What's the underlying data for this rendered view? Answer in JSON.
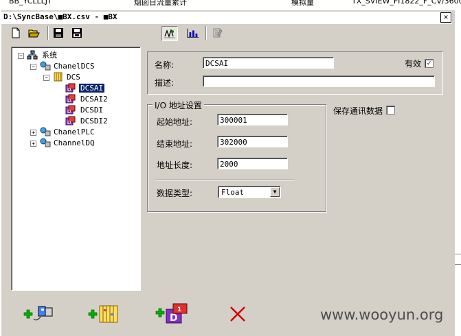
{
  "background_strip": {
    "col1": "BB_YCLLLJT",
    "col2": "烟囱日流量累计",
    "col3": "模拟量",
    "col4": "TX_SVIEW_FI1822_F_CV/3600"
  },
  "window": {
    "title": "D:\\SyncBase\\■BX.csv - ■BX",
    "close_label": "✕"
  },
  "toolbar": {
    "icons": [
      "new-icon",
      "open-icon",
      "save-icon",
      "save-all-icon",
      "signal-icon",
      "bar-chart-icon",
      "edit-doc-icon"
    ]
  },
  "tree": {
    "root": "系统",
    "nodes": {
      "chaneldcs": "ChanelDCS",
      "dcs": "DCS",
      "dcsai": "DCSAI",
      "dcsai2": "DCSAI2",
      "dcsdi": "DCSDI",
      "dcsdi2": "DCSDI2",
      "chanelplc": "ChanelPLC",
      "channeldq": "ChannelDQ"
    },
    "expander_minus": "−",
    "expander_plus": "+"
  },
  "props": {
    "name_label": "名称:",
    "name_value": "DCSAI",
    "valid_label": "有效",
    "valid_checked": "✓",
    "desc_label": "描述:",
    "desc_value": "",
    "save_comm_label": "保存通讯数据",
    "io_group_title": "I/O 地址设置",
    "start_label": "起始地址:",
    "start_value": "300001",
    "end_label": "结束地址:",
    "end_value": "302000",
    "length_label": "地址长度:",
    "length_value": "2000",
    "dtype_label": "数据类型:",
    "dtype_value": "Float",
    "dropdown_arrow": "▼"
  },
  "bottom_toolbar": {
    "icons": [
      "add-channel-icon",
      "add-device-icon",
      "add-datablock-icon",
      "delete-icon"
    ]
  },
  "watermark": "www.wooyun.org"
}
